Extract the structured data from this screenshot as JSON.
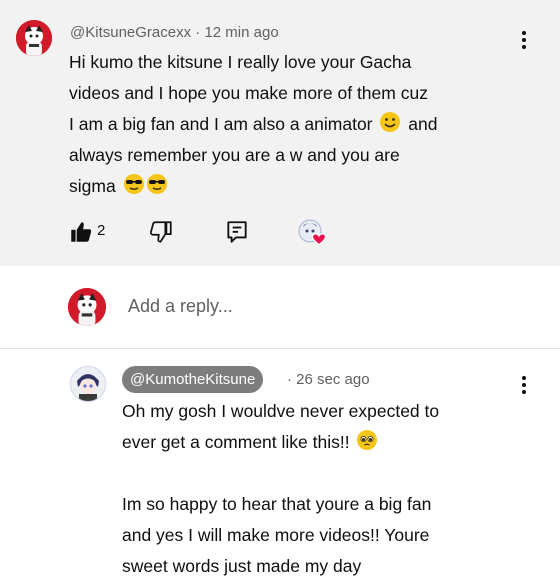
{
  "comment": {
    "author": "@KitsuneGracexx",
    "time": "· 12 min ago",
    "lines": [
      "Hi kumo the kitsune I really love your Gacha",
      "videos and I hope you make more of them cuz",
      "I am a big fan and I am also a animator",
      "and",
      "always remember you are a w and you are",
      "sigma"
    ],
    "like_count": "2",
    "icons": {
      "like": "thumbs-up-icon",
      "dislike": "thumbs-down-icon",
      "reply": "reply-icon",
      "heart": "creator-heart-icon",
      "more": "more-vert-icon"
    }
  },
  "reply_box": {
    "placeholder": "Add a reply..."
  },
  "creator_reply": {
    "author": "@KumotheKitsune",
    "time": "· 26 sec ago",
    "lines": [
      "Oh my gosh I wouldve never expected to",
      "ever get a comment like this!!",
      "",
      "Im so happy to hear that youre a big fan",
      "and yes I will make more videos!! Youre",
      "sweet words just made my day"
    ]
  },
  "colors": {
    "comment_bg": "#f2f2f2",
    "avatar_red": "#d11a2a",
    "chip_gray": "#7d7d7d",
    "heart_red": "#e8134f",
    "text": "#0f0f0f",
    "secondary_text": "#606060"
  }
}
